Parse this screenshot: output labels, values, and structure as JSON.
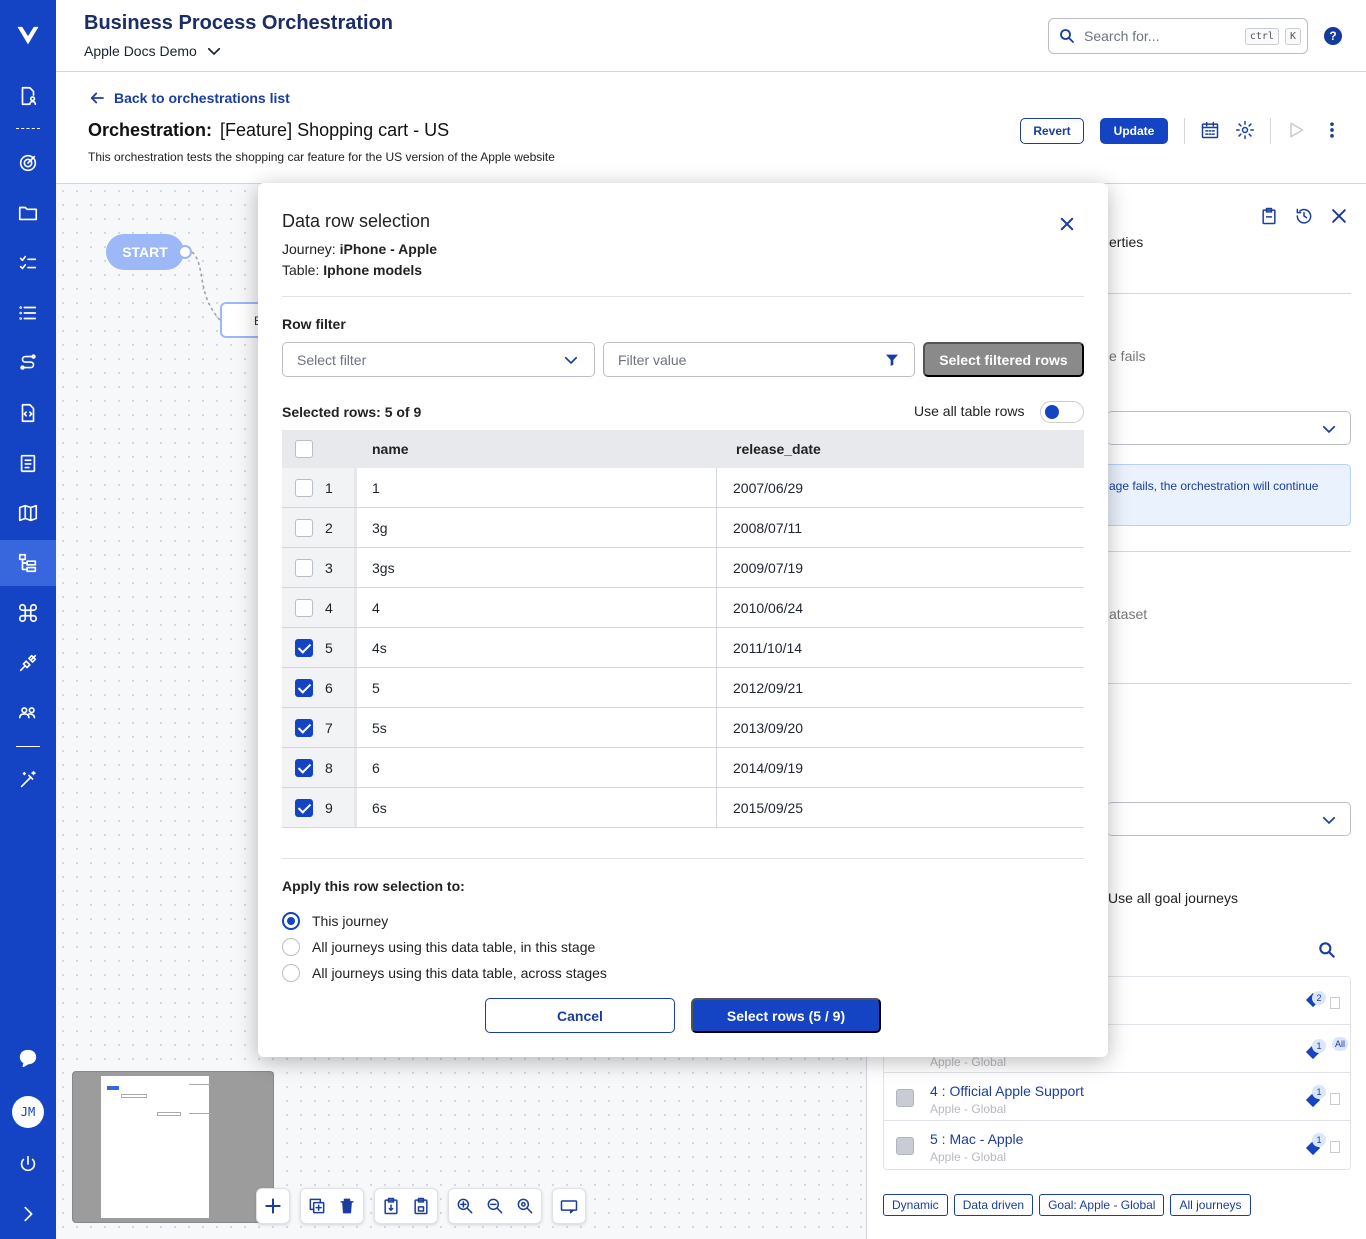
{
  "header": {
    "app_title": "Business Process Orchestration",
    "workspace": "Apple Docs Demo",
    "search_placeholder": "Search for...",
    "search_shortcut_1": "ctrl",
    "search_shortcut_2": "K",
    "help": "?"
  },
  "sidebar": {
    "items": [
      "document-person-icon",
      "target-icon",
      "folder-icon",
      "checklist-icon",
      "list-icon",
      "route-icon",
      "file-code-icon",
      "clipboard-icon",
      "map-icon",
      "orchestration-icon",
      "command-icon",
      "plug-icon",
      "users-icon",
      "magic-icon"
    ],
    "active": "orchestration-icon",
    "avatar_initials": "JM"
  },
  "page": {
    "back_label": "Back to orchestrations list",
    "title_prefix": "Orchestration:",
    "title": "[Feature] Shopping cart - US",
    "description": "This orchestration tests the shopping car feature for the US version of the Apple website",
    "revert_label": "Revert",
    "update_label": "Update"
  },
  "canvas": {
    "start_label": "START",
    "node_b_label": "E"
  },
  "right_panel": {
    "frag_properties": "erties",
    "frag_fails": "e fails",
    "frag_info": "age fails, the orchestration will continue",
    "frag_dataset": "ataset",
    "use_all_goal": "Use all goal journeys",
    "list": [
      {
        "title": "",
        "sub": "",
        "badge": "2"
      },
      {
        "title": "",
        "sub": "Apple - Global",
        "badge": "1",
        "extra": "All"
      },
      {
        "title": "4 : Official Apple Support",
        "sub": "Apple - Global",
        "badge": "1"
      },
      {
        "title": "5 : Mac - Apple",
        "sub": "Apple - Global",
        "badge": "1"
      }
    ],
    "chips": [
      "Dynamic",
      "Data driven",
      "Goal: Apple - Global",
      "All journeys"
    ]
  },
  "modal": {
    "title": "Data row selection",
    "journey_label": "Journey:",
    "journey_value": "iPhone - Apple",
    "table_label": "Table:",
    "table_value": "Iphone models",
    "row_filter_label": "Row filter",
    "select_filter_placeholder": "Select filter",
    "filter_value_placeholder": "Filter value",
    "select_filtered_label": "Select filtered rows",
    "selected_rows_text": "Selected rows: 5 of 9",
    "use_all_rows_label": "Use all table rows",
    "use_all_rows_on": false,
    "columns": [
      "name",
      "release_date"
    ],
    "rows": [
      {
        "n": "1",
        "name": "1",
        "release_date": "2007/06/29",
        "checked": false
      },
      {
        "n": "2",
        "name": "3g",
        "release_date": "2008/07/11",
        "checked": false
      },
      {
        "n": "3",
        "name": "3gs",
        "release_date": "2009/07/19",
        "checked": false
      },
      {
        "n": "4",
        "name": "4",
        "release_date": "2010/06/24",
        "checked": false
      },
      {
        "n": "5",
        "name": "4s",
        "release_date": "2011/10/14",
        "checked": true
      },
      {
        "n": "6",
        "name": "5",
        "release_date": "2012/09/21",
        "checked": true
      },
      {
        "n": "7",
        "name": "5s",
        "release_date": "2013/09/20",
        "checked": true
      },
      {
        "n": "8",
        "name": "6",
        "release_date": "2014/09/19",
        "checked": true
      },
      {
        "n": "9",
        "name": "6s",
        "release_date": "2015/09/25",
        "checked": true
      }
    ],
    "apply_label": "Apply this row selection to:",
    "options": [
      "This journey",
      "All journeys using this data table, in this stage",
      "All journeys using this data table, across stages"
    ],
    "selected_option": 0,
    "cancel_label": "Cancel",
    "confirm_label": "Select rows (5 / 9)"
  },
  "colors": {
    "brand": "#1443c4",
    "brand_dark": "#1a3d9e",
    "disabled_button": "#8a8a8a"
  }
}
